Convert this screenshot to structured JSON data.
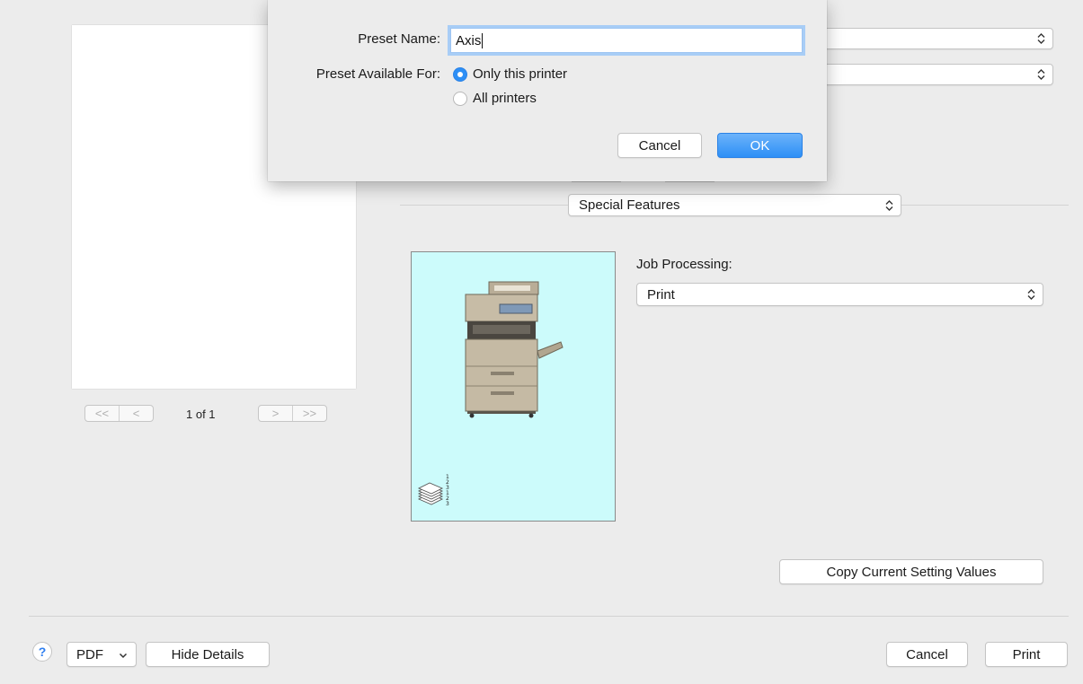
{
  "preview": {
    "first_symbol": "<<",
    "prev_symbol": "<",
    "page_label": "1 of 1",
    "next_symbol": ">",
    "last_symbol": ">>"
  },
  "panel": {
    "special_features_label": "Special Features",
    "job_processing_label": "Job Processing:",
    "job_processing_value": "Print",
    "copy_settings_button": "Copy Current Setting Values"
  },
  "sheet": {
    "preset_name_label": "Preset Name:",
    "preset_name_value": "Axis",
    "available_for_label": "Preset Available For:",
    "option_only_this": "Only this printer",
    "option_all": "All printers",
    "selected_option": "Only this printer",
    "cancel_label": "Cancel",
    "ok_label": "OK"
  },
  "footer": {
    "help_symbol": "?",
    "pdf_label": "PDF",
    "hide_details_label": "Hide Details",
    "cancel_label": "Cancel",
    "print_label": "Print"
  },
  "icons": {
    "help": "question-mark-icon",
    "popup_arrows": "up-down-chevron-icon",
    "dropdown": "chevron-down-icon",
    "printer": "multifunction-printer-icon",
    "collate": "collated-stack-icon"
  },
  "colors": {
    "accent": "#2d8ff6",
    "printer_bg": "#ccfbfb",
    "window_bg": "#ececec"
  }
}
